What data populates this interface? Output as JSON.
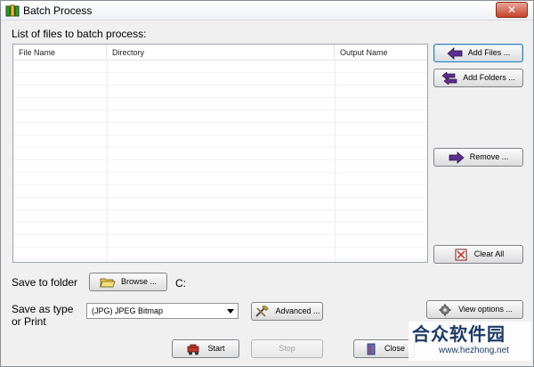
{
  "window": {
    "title": "Batch Process",
    "close_glyph": "✕"
  },
  "list_label": "List of files to batch process:",
  "table": {
    "columns": [
      "File Name",
      "Directory",
      "Output Name"
    ],
    "rows": []
  },
  "buttons": {
    "add_files": "Add Files ...",
    "add_folders": "Add Folders ...",
    "remove": "Remove ...",
    "clear_all": "Clear All",
    "browse": "Browse ...",
    "advanced": "Advanced ...",
    "view_options": "View options ...",
    "start": "Start",
    "stop": "Stop",
    "close": "Close"
  },
  "save_to_folder": {
    "label": "Save to folder",
    "path": "C:"
  },
  "save_as": {
    "label_line1": "Save as type",
    "label_line2": "or Print",
    "selected": "(JPG) JPEG Bitmap"
  },
  "watermark": {
    "title": "合众软件园",
    "url": "www.hezhong.net"
  },
  "colors": {
    "arrow_purple": "#5b2d8e",
    "danger_red": "#c0392b",
    "brand_navy": "#1d3a66"
  }
}
